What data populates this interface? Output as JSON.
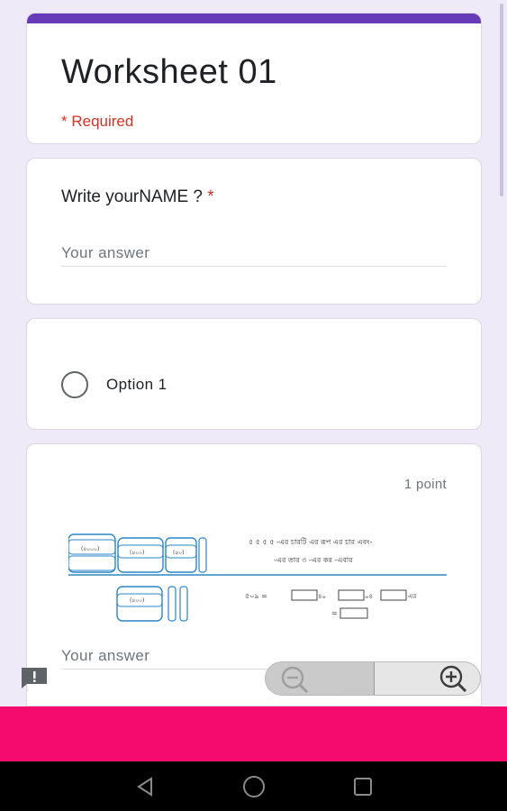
{
  "form": {
    "title": "Worksheet 01",
    "required_note": "* Required",
    "accent_color": "#673ab7"
  },
  "question1": {
    "label": "Write yourNAME ?",
    "required_star": "*",
    "placeholder": "Your answer"
  },
  "question2": {
    "option_label": "Option 1"
  },
  "question3": {
    "points": "1 point",
    "image_top_text_1": "৫ ৫ ৫ ৫ -এর চারটি এর রূপ এর চার এবং-",
    "image_top_text_2": "-এর তার ৩ -এর কর -এবার",
    "image_eq_left": "৫০৯  =",
    "image_eq_bottom": "=",
    "placeholder": "Your answer"
  },
  "colors": {
    "page_bg": "#efeaf7",
    "required_red": "#d93025",
    "bottom_bar_pink": "#f50a6d",
    "nav_black": "#000000"
  },
  "icons": {
    "feedback": "feedback-icon",
    "zoom_out": "zoom-out-icon",
    "zoom_in": "zoom-in-icon",
    "nav_back": "back-triangle-icon",
    "nav_home": "home-circle-icon",
    "nav_recents": "recents-square-icon"
  }
}
